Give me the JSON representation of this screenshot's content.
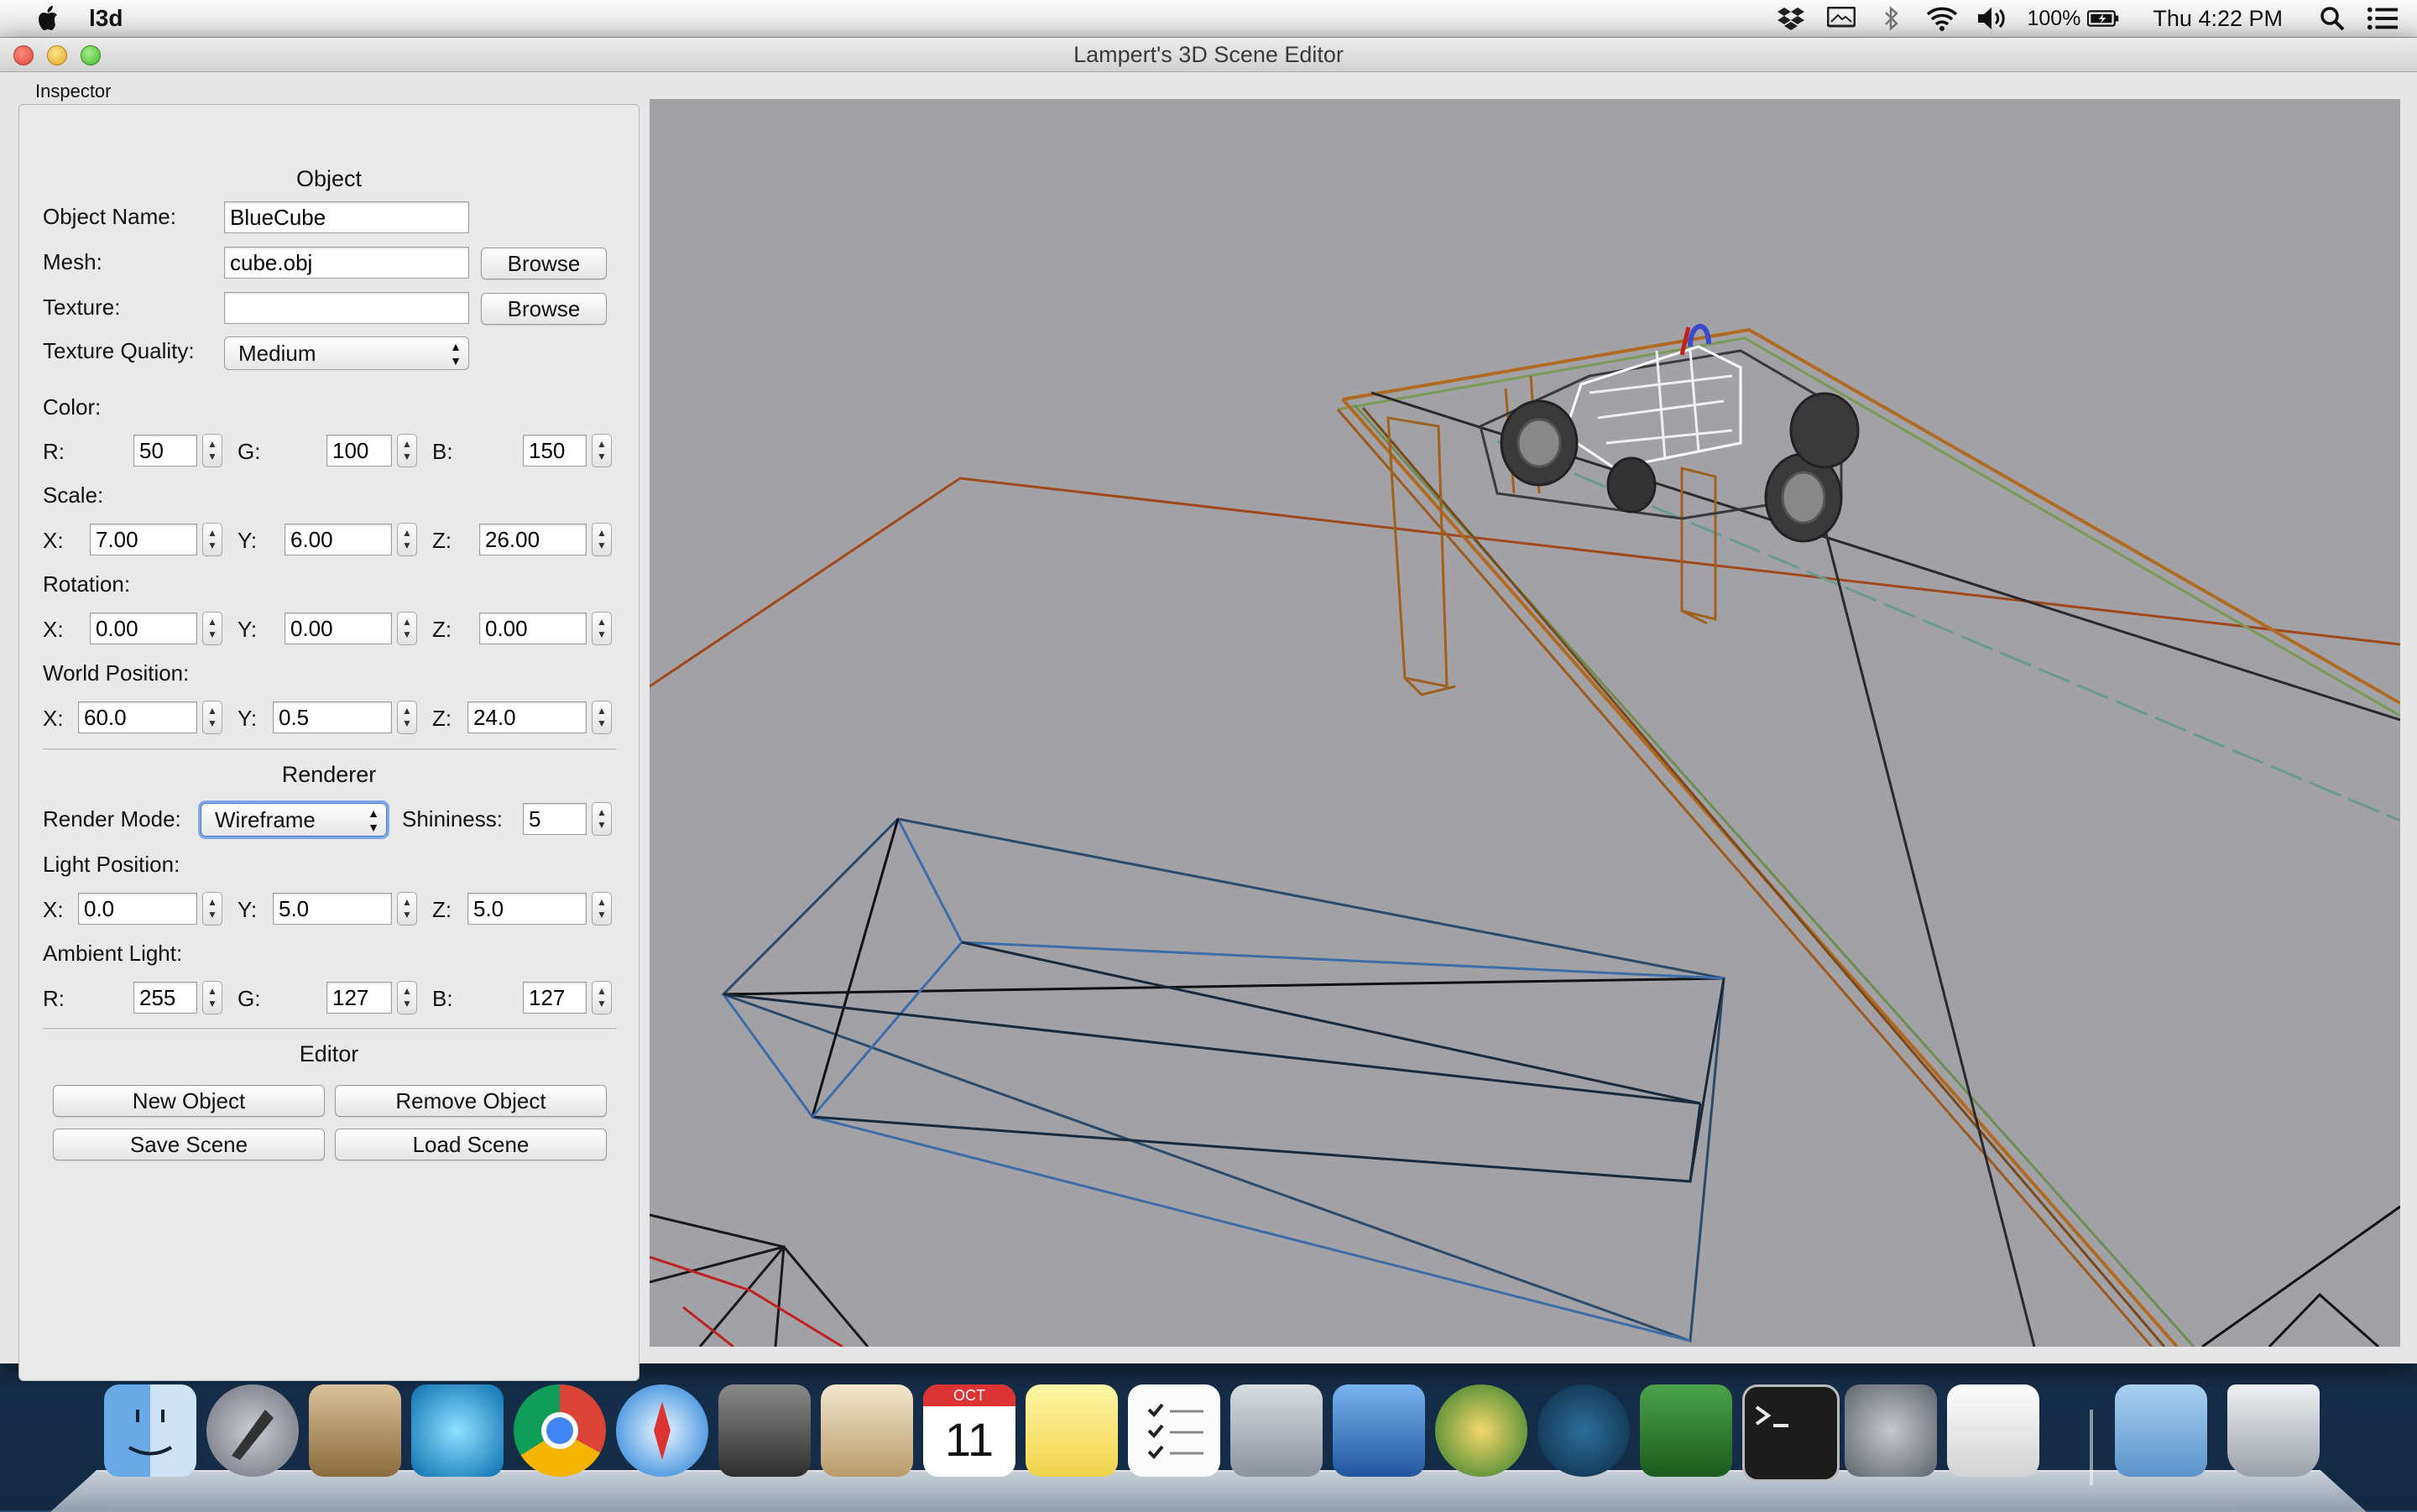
{
  "menubar": {
    "app_name": "l3d",
    "battery_percent": "100%",
    "clock": "Thu 4:22 PM",
    "icons": [
      "apple-icon",
      "dropbox-icon",
      "display-icon",
      "bluetooth-icon",
      "wifi-icon",
      "volume-icon",
      "battery-icon",
      "spotlight-icon",
      "notification-list-icon"
    ]
  },
  "window": {
    "title": "Lampert's 3D Scene Editor"
  },
  "inspector": {
    "tab_label": "Inspector",
    "object": {
      "section_title": "Object",
      "name_label": "Object Name:",
      "name_value": "BlueCube",
      "mesh_label": "Mesh:",
      "mesh_value": "cube.obj",
      "texture_label": "Texture:",
      "texture_value": "",
      "browse_label": "Browse",
      "texture_quality_label": "Texture Quality:",
      "texture_quality_value": "Medium",
      "color_label": "Color:",
      "color": {
        "r_label": "R:",
        "r": "50",
        "g_label": "G:",
        "g": "100",
        "b_label": "B:",
        "b": "150"
      },
      "scale_label": "Scale:",
      "scale": {
        "x_label": "X:",
        "x": "7.00",
        "y_label": "Y:",
        "y": "6.00",
        "z_label": "Z:",
        "z": "26.00"
      },
      "rotation_label": "Rotation:",
      "rotation": {
        "x_label": "X:",
        "x": "0.00",
        "y_label": "Y:",
        "y": "0.00",
        "z_label": "Z:",
        "z": "0.00"
      },
      "world_position_label": "World Position:",
      "world_position": {
        "x_label": "X:",
        "x": "60.0",
        "y_label": "Y:",
        "y": "0.5",
        "z_label": "Z:",
        "z": "24.0"
      }
    },
    "renderer": {
      "section_title": "Renderer",
      "render_mode_label": "Render Mode:",
      "render_mode_value": "Wireframe",
      "shininess_label": "Shininess:",
      "shininess_value": "5",
      "light_position_label": "Light Position:",
      "light_position": {
        "x_label": "X:",
        "x": "0.0",
        "y_label": "Y:",
        "y": "5.0",
        "z_label": "Z:",
        "z": "5.0"
      },
      "ambient_light_label": "Ambient Light:",
      "ambient": {
        "r_label": "R:",
        "r": "255",
        "g_label": "G:",
        "g": "127",
        "b_label": "B:",
        "b": "127"
      }
    },
    "editor": {
      "section_title": "Editor",
      "new_object": "New Object",
      "remove_object": "Remove Object",
      "save_scene": "Save Scene",
      "load_scene": "Load Scene"
    }
  },
  "viewport": {
    "background_color": "#a1a1a6",
    "render_mode": "wireframe"
  },
  "dock": {
    "items": [
      "finder-icon",
      "launchpad-icon",
      "photo-browser-icon",
      "screensaver-icon",
      "chrome-icon",
      "safari-icon",
      "steam-icon",
      "mail-icon",
      "calendar-icon",
      "notes-icon",
      "reminders-icon",
      "calculator-icon",
      "xcode-icon",
      "artichoke-icon",
      "sourcetree-icon",
      "vim-icon",
      "terminal-icon",
      "system-preferences-icon",
      "text-edit-icon",
      "downloads-folder-icon",
      "trash-icon"
    ],
    "calendar_month": "OCT",
    "calendar_day": "11"
  }
}
